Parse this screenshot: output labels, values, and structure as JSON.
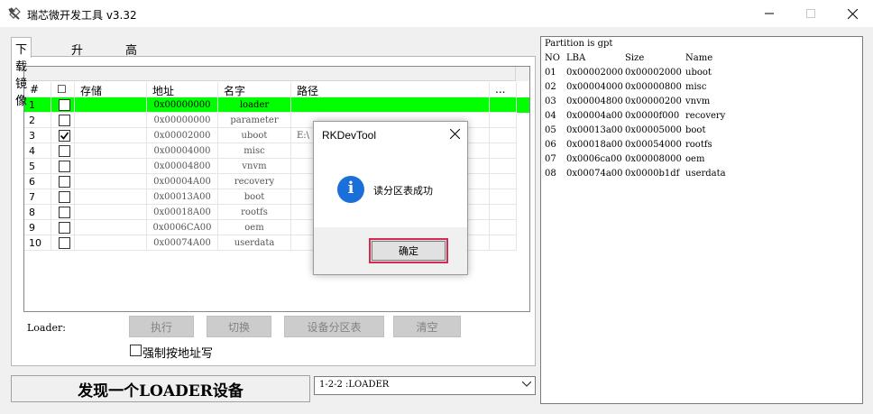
{
  "window": {
    "title": "瑞芯微开发工具 v3.32",
    "icon": "tool-icon"
  },
  "tabs": [
    {
      "label": "下载镜像",
      "active": true
    },
    {
      "label": "升级固件",
      "active": false
    },
    {
      "label": "高级功能",
      "active": false
    }
  ],
  "table": {
    "headers": {
      "index": "#",
      "check": "☐",
      "storage": "存储",
      "address": "地址",
      "name": "名字",
      "path": "路径",
      "more": "..."
    },
    "rows": [
      {
        "index": "1",
        "checked": false,
        "address": "0x00000000",
        "name": "loader",
        "path": "",
        "selected": true
      },
      {
        "index": "2",
        "checked": false,
        "address": "0x00000000",
        "name": "parameter",
        "path": "",
        "selected": false
      },
      {
        "index": "3",
        "checked": true,
        "address": "0x00002000",
        "name": "uboot",
        "path": "E:\\",
        "selected": false
      },
      {
        "index": "4",
        "checked": false,
        "address": "0x00004000",
        "name": "misc",
        "path": "",
        "selected": false
      },
      {
        "index": "5",
        "checked": false,
        "address": "0x00004800",
        "name": "vnvm",
        "path": "",
        "selected": false
      },
      {
        "index": "6",
        "checked": false,
        "address": "0x00004A00",
        "name": "recovery",
        "path": "",
        "selected": false
      },
      {
        "index": "7",
        "checked": false,
        "address": "0x00013A00",
        "name": "boot",
        "path": "",
        "selected": false
      },
      {
        "index": "8",
        "checked": false,
        "address": "0x00018A00",
        "name": "rootfs",
        "path": "",
        "selected": false
      },
      {
        "index": "9",
        "checked": false,
        "address": "0x0006CA00",
        "name": "oem",
        "path": "",
        "selected": false
      },
      {
        "index": "10",
        "checked": false,
        "address": "0x00074A00",
        "name": "userdata",
        "path": "",
        "selected": false
      }
    ]
  },
  "controls": {
    "loader_label": "Loader:",
    "run_label": "执行",
    "switch_label": "切换",
    "partition_table_label": "设备分区表",
    "clear_label": "清空",
    "force_address_label": "强制按地址写"
  },
  "status": {
    "message": "发现一个LOADER设备",
    "device_select": "1-2-2 :LOADER"
  },
  "partition_panel": {
    "header": "Partition is gpt",
    "columns": [
      "NO",
      "LBA",
      "Size",
      "Name"
    ],
    "rows": [
      [
        "01",
        "0x00002000",
        "0x00002000",
        "uboot"
      ],
      [
        "02",
        "0x00004000",
        "0x00000800",
        "misc"
      ],
      [
        "03",
        "0x00004800",
        "0x00000200",
        "vnvm"
      ],
      [
        "04",
        "0x00004a00",
        "0x0000f000",
        "recovery"
      ],
      [
        "05",
        "0x00013a00",
        "0x00005000",
        "boot"
      ],
      [
        "06",
        "0x00018a00",
        "0x00054000",
        "rootfs"
      ],
      [
        "07",
        "0x0006ca00",
        "0x00008000",
        "oem"
      ],
      [
        "08",
        "0x00074a00",
        "0x0000b1df",
        "userdata"
      ]
    ]
  },
  "dialog": {
    "title": "RKDevTool",
    "icon": "info-icon",
    "info_glyph": "i",
    "message": "读分区表成功",
    "ok_label": "确定"
  },
  "colors": {
    "selected_row": "#00ff00",
    "ok_button_border": "#d22c52",
    "info_icon": "#1a6fd8"
  }
}
